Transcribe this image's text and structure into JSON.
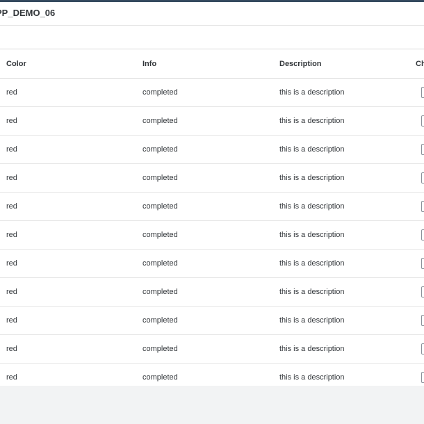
{
  "app": {
    "title": "PP_DEMO_06"
  },
  "table": {
    "columns": [
      "Color",
      "Info",
      "Description",
      "Ch"
    ],
    "rows": [
      {
        "color": "red",
        "info": "completed",
        "description": "this is a description"
      },
      {
        "color": "red",
        "info": "completed",
        "description": "this is a description"
      },
      {
        "color": "red",
        "info": "completed",
        "description": "this is a description"
      },
      {
        "color": "red",
        "info": "completed",
        "description": "this is a description"
      },
      {
        "color": "red",
        "info": "completed",
        "description": "this is a description"
      },
      {
        "color": "red",
        "info": "completed",
        "description": "this is a description"
      },
      {
        "color": "red",
        "info": "completed",
        "description": "this is a description"
      },
      {
        "color": "red",
        "info": "completed",
        "description": "this is a description"
      },
      {
        "color": "red",
        "info": "completed",
        "description": "this is a description"
      },
      {
        "color": "red",
        "info": "completed",
        "description": "this is a description"
      },
      {
        "color": "red",
        "info": "completed",
        "description": "this is a description"
      }
    ]
  }
}
